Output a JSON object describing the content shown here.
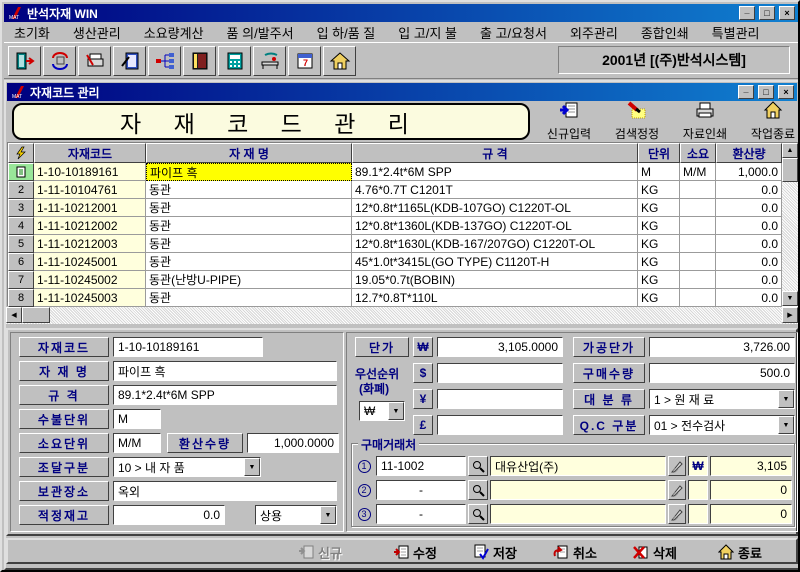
{
  "icons": {
    "minimize": "_",
    "maximize": "□",
    "close": "×",
    "dropdown": "▼",
    "up": "▲",
    "down": "▼",
    "left": "◀",
    "right": "▶"
  },
  "window": {
    "title": "반석자재 WIN",
    "logo_text": "MAT"
  },
  "menu": [
    "초기화",
    "생산관리",
    "소요량계산",
    "품 의/발주서",
    "입 하/품 질",
    "입 고/지 불",
    "출 고/요청서",
    "외주관리",
    "종합인쇄",
    "특별관리"
  ],
  "toolbar": {
    "year_company": "2001년  [(주)반석시스템]",
    "buttons": [
      "exit-icon",
      "refresh-icon",
      "print-icon",
      "search-book-icon",
      "hierarchy-icon",
      "notebook-icon",
      "calculator-icon",
      "tools-icon",
      "calendar-icon",
      "home-icon"
    ]
  },
  "child": {
    "title": "자재코드 관리",
    "banner": "자 재 코 드 관 리",
    "actions": [
      {
        "label": "신규입력",
        "icon": "new-doc-icon"
      },
      {
        "label": "검색정정",
        "icon": "flashlight-icon"
      },
      {
        "label": "자료인쇄",
        "icon": "printer-icon"
      },
      {
        "label": "작업종료",
        "icon": "home-icon"
      }
    ]
  },
  "table": {
    "headers": {
      "code": "자재코드",
      "name": "자  재  명",
      "spec": "규        격",
      "unit": "단위",
      "req": "소요",
      "conv": "환산량"
    },
    "rows": [
      {
        "num": "1",
        "code": "1-10-10189161",
        "name": "파이프 흑",
        "spec": "89.1*2.4t*6M SPP",
        "unit": "M",
        "req": "M/M",
        "conv": "1,000.0"
      },
      {
        "num": "2",
        "code": "1-11-10104761",
        "name": "동관",
        "spec": "4.76*0.7T C1201T",
        "unit": "KG",
        "req": "",
        "conv": "0.0"
      },
      {
        "num": "3",
        "code": "1-11-10212001",
        "name": "동관",
        "spec": "12*0.8t*1165L(KDB-107GO) C1220T-OL",
        "unit": "KG",
        "req": "",
        "conv": "0.0"
      },
      {
        "num": "4",
        "code": "1-11-10212002",
        "name": "동관",
        "spec": "12*0.8t*1360L(KDB-137GO) C1220T-OL",
        "unit": "KG",
        "req": "",
        "conv": "0.0"
      },
      {
        "num": "5",
        "code": "1-11-10212003",
        "name": "동관",
        "spec": "12*0.8t*1630L(KDB-167/207GO) C1220T-OL",
        "unit": "KG",
        "req": "",
        "conv": "0.0"
      },
      {
        "num": "6",
        "code": "1-11-10245001",
        "name": "동관",
        "spec": "45*1.0t*3415L(GO TYPE) C1120T-H",
        "unit": "KG",
        "req": "",
        "conv": "0.0"
      },
      {
        "num": "7",
        "code": "1-11-10245002",
        "name": "동관(난방U-PIPE)",
        "spec": "19.05*0.7t(BOBIN)",
        "unit": "KG",
        "req": "",
        "conv": "0.0"
      },
      {
        "num": "8",
        "code": "1-11-10245003",
        "name": "동관",
        "spec": "12.7*0.8T*110L",
        "unit": "KG",
        "req": "",
        "conv": "0.0"
      }
    ]
  },
  "form": {
    "labels": {
      "code": "자재코드",
      "name": "자 재 명",
      "spec": "규      격",
      "unit": "수불단위",
      "requnit": "소요단위",
      "conv": "환산수량",
      "procure": "조달구분",
      "storage": "보관장소",
      "stock": "적정재고",
      "price": "단가",
      "priority1": "우선순위",
      "priority2": "(화폐)",
      "procprice": "가공단가",
      "qty": "구매수량",
      "category": "대 분 류",
      "qc": "Q.C 구분"
    },
    "values": {
      "code": "1-10-10189161",
      "name": "파이프 흑",
      "spec": "89.1*2.4t*6M SPP",
      "unit": "M",
      "requnit": "M/M",
      "conv": "1,000.0000",
      "procure": "10 >  내  자  품",
      "storage": "옥외",
      "stock": "0.0",
      "stock_type": "상용",
      "priority_currency": "₩",
      "price_won": "3,105.0000",
      "price_dollar": "",
      "price_yen": "",
      "price_pound": "",
      "procprice": "3,726.00",
      "qty": "500.0",
      "category": "1 >  원 재 료",
      "qc": "01 >  전수검사"
    },
    "currency_symbols": {
      "won": "₩",
      "dollar": "$",
      "yen": "¥",
      "pound": "£"
    }
  },
  "vendors": {
    "title": "구매거래처",
    "rows": [
      {
        "no": "1",
        "code": "11-1002",
        "name": "대유산업(주)",
        "currency": "₩",
        "price": "3,105"
      },
      {
        "no": "2",
        "code": "-",
        "name": "",
        "currency": "",
        "price": "0"
      },
      {
        "no": "3",
        "code": "-",
        "name": "",
        "currency": "",
        "price": "0"
      }
    ]
  },
  "footer": {
    "buttons": [
      {
        "label": "신규",
        "disabled": true
      },
      {
        "label": "수정"
      },
      {
        "label": "저장"
      },
      {
        "label": "취소"
      },
      {
        "label": "삭제"
      },
      {
        "label": "종료"
      }
    ]
  }
}
